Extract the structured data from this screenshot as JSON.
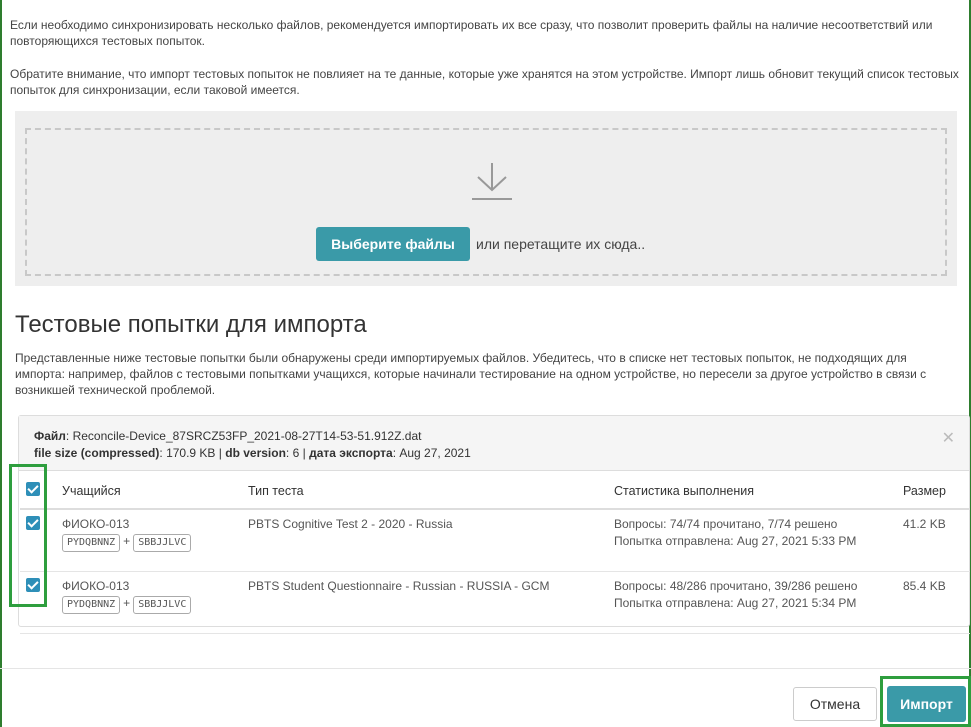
{
  "intro": {
    "paragraph1": "Если необходимо синхронизировать несколько файлов, рекомендуется импортировать их все сразу, что позволит проверить файлы на наличие несоответствий или повторяющихся тестовых попыток.",
    "paragraph2": "Обратите внимание, что импорт тестовых попыток не повлияет на те данные, которые уже хранятся на этом устройстве. Импорт лишь обновит текущий список тестовых попыток для синхронизации, если таковой имеется."
  },
  "dropzone": {
    "icon": "download-arrow-icon",
    "choose_button": "Выберите файлы",
    "drop_text": "или перетащите их сюда.."
  },
  "section": {
    "title": "Тестовые попытки для импорта",
    "description": "Представленные ниже тестовые попытки были обнаружены среди импортируемых файлов. Убедитесь, что в списке нет тестовых попыток, не подходящих для импорта: например, файлов с тестовыми попытками учащихся, которые начинали тестирование на одном устройстве, но пересели за другое устройство в связи с возникшей технической проблемой."
  },
  "file": {
    "file_label": "Файл",
    "file_name": "Reconcile-Device_87SRCZ53FP_2021-08-27T14-53-51.912Z.dat",
    "size_label": "file size (compressed)",
    "size_value": "170.9 KB",
    "db_label": "db version",
    "db_value": "6",
    "date_label": "дата экспорта",
    "date_value": "Aug 27, 2021",
    "close_icon": "close-icon"
  },
  "table": {
    "headers": {
      "student": "Учащийся",
      "test_type": "Тип теста",
      "stats": "Статистика выполнения",
      "size": "Размер"
    },
    "rows": [
      {
        "student": "ФИОКО-013",
        "tag1": "PYDQBNNZ",
        "tag2": "SBBJJLVC",
        "test_type": "PBTS Cognitive Test 2 - 2020 - Russia",
        "stats_line1": "Вопросы: 74/74 прочитано, 7/74 решено",
        "stats_line2": "Попытка отправлена: Aug 27, 2021 5:33 PM",
        "size": "41.2 KB"
      },
      {
        "student": "ФИОКО-013",
        "tag1": "PYDQBNNZ",
        "tag2": "SBBJJLVC",
        "test_type": "PBTS Student Questionnaire - Russian - RUSSIA - GCM",
        "stats_line1": "Вопросы: 48/286 прочитано, 39/286 решено",
        "stats_line2": "Попытка отправлена: Aug 27, 2021 5:34 PM",
        "size": "85.4 KB"
      }
    ]
  },
  "footer": {
    "cancel": "Отмена",
    "import": "Импорт"
  },
  "colors": {
    "accent": "#3a9aa8",
    "checkbox": "#2e8fb8",
    "highlight": "#2e9e3e"
  }
}
